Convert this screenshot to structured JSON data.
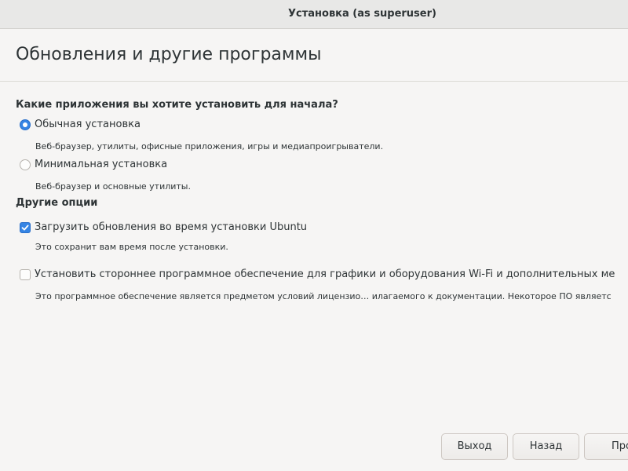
{
  "window": {
    "title": "Установка (as superuser)"
  },
  "page": {
    "title": "Обновления и другие программы"
  },
  "apps_section": {
    "heading": "Какие приложения вы хотите установить для начала?",
    "options": [
      {
        "label": "Обычная установка",
        "description": "Веб-браузер, утилиты, офисные приложения, игры и медиапроигрыватели.",
        "selected": true
      },
      {
        "label": "Минимальная установка",
        "description": "Веб-браузер и основные утилиты.",
        "selected": false
      }
    ]
  },
  "other_section": {
    "heading": "Другие опции",
    "options": [
      {
        "label": "Загрузить обновления во время установки Ubuntu",
        "description": "Это сохранит вам время после установки.",
        "checked": true
      },
      {
        "label": "Установить стороннее программное обеспечение для графики и оборудования Wi-Fi и дополнительных ме",
        "description": "Это программное обеспечение является предметом условий лицензио… илагаемого к документации. Некоторое ПО являетс",
        "checked": false
      }
    ]
  },
  "buttons": {
    "quit": "Выход",
    "back": "Назад",
    "continue": "Про"
  },
  "colors": {
    "accent": "#3584e4",
    "background": "#f6f5f4"
  }
}
